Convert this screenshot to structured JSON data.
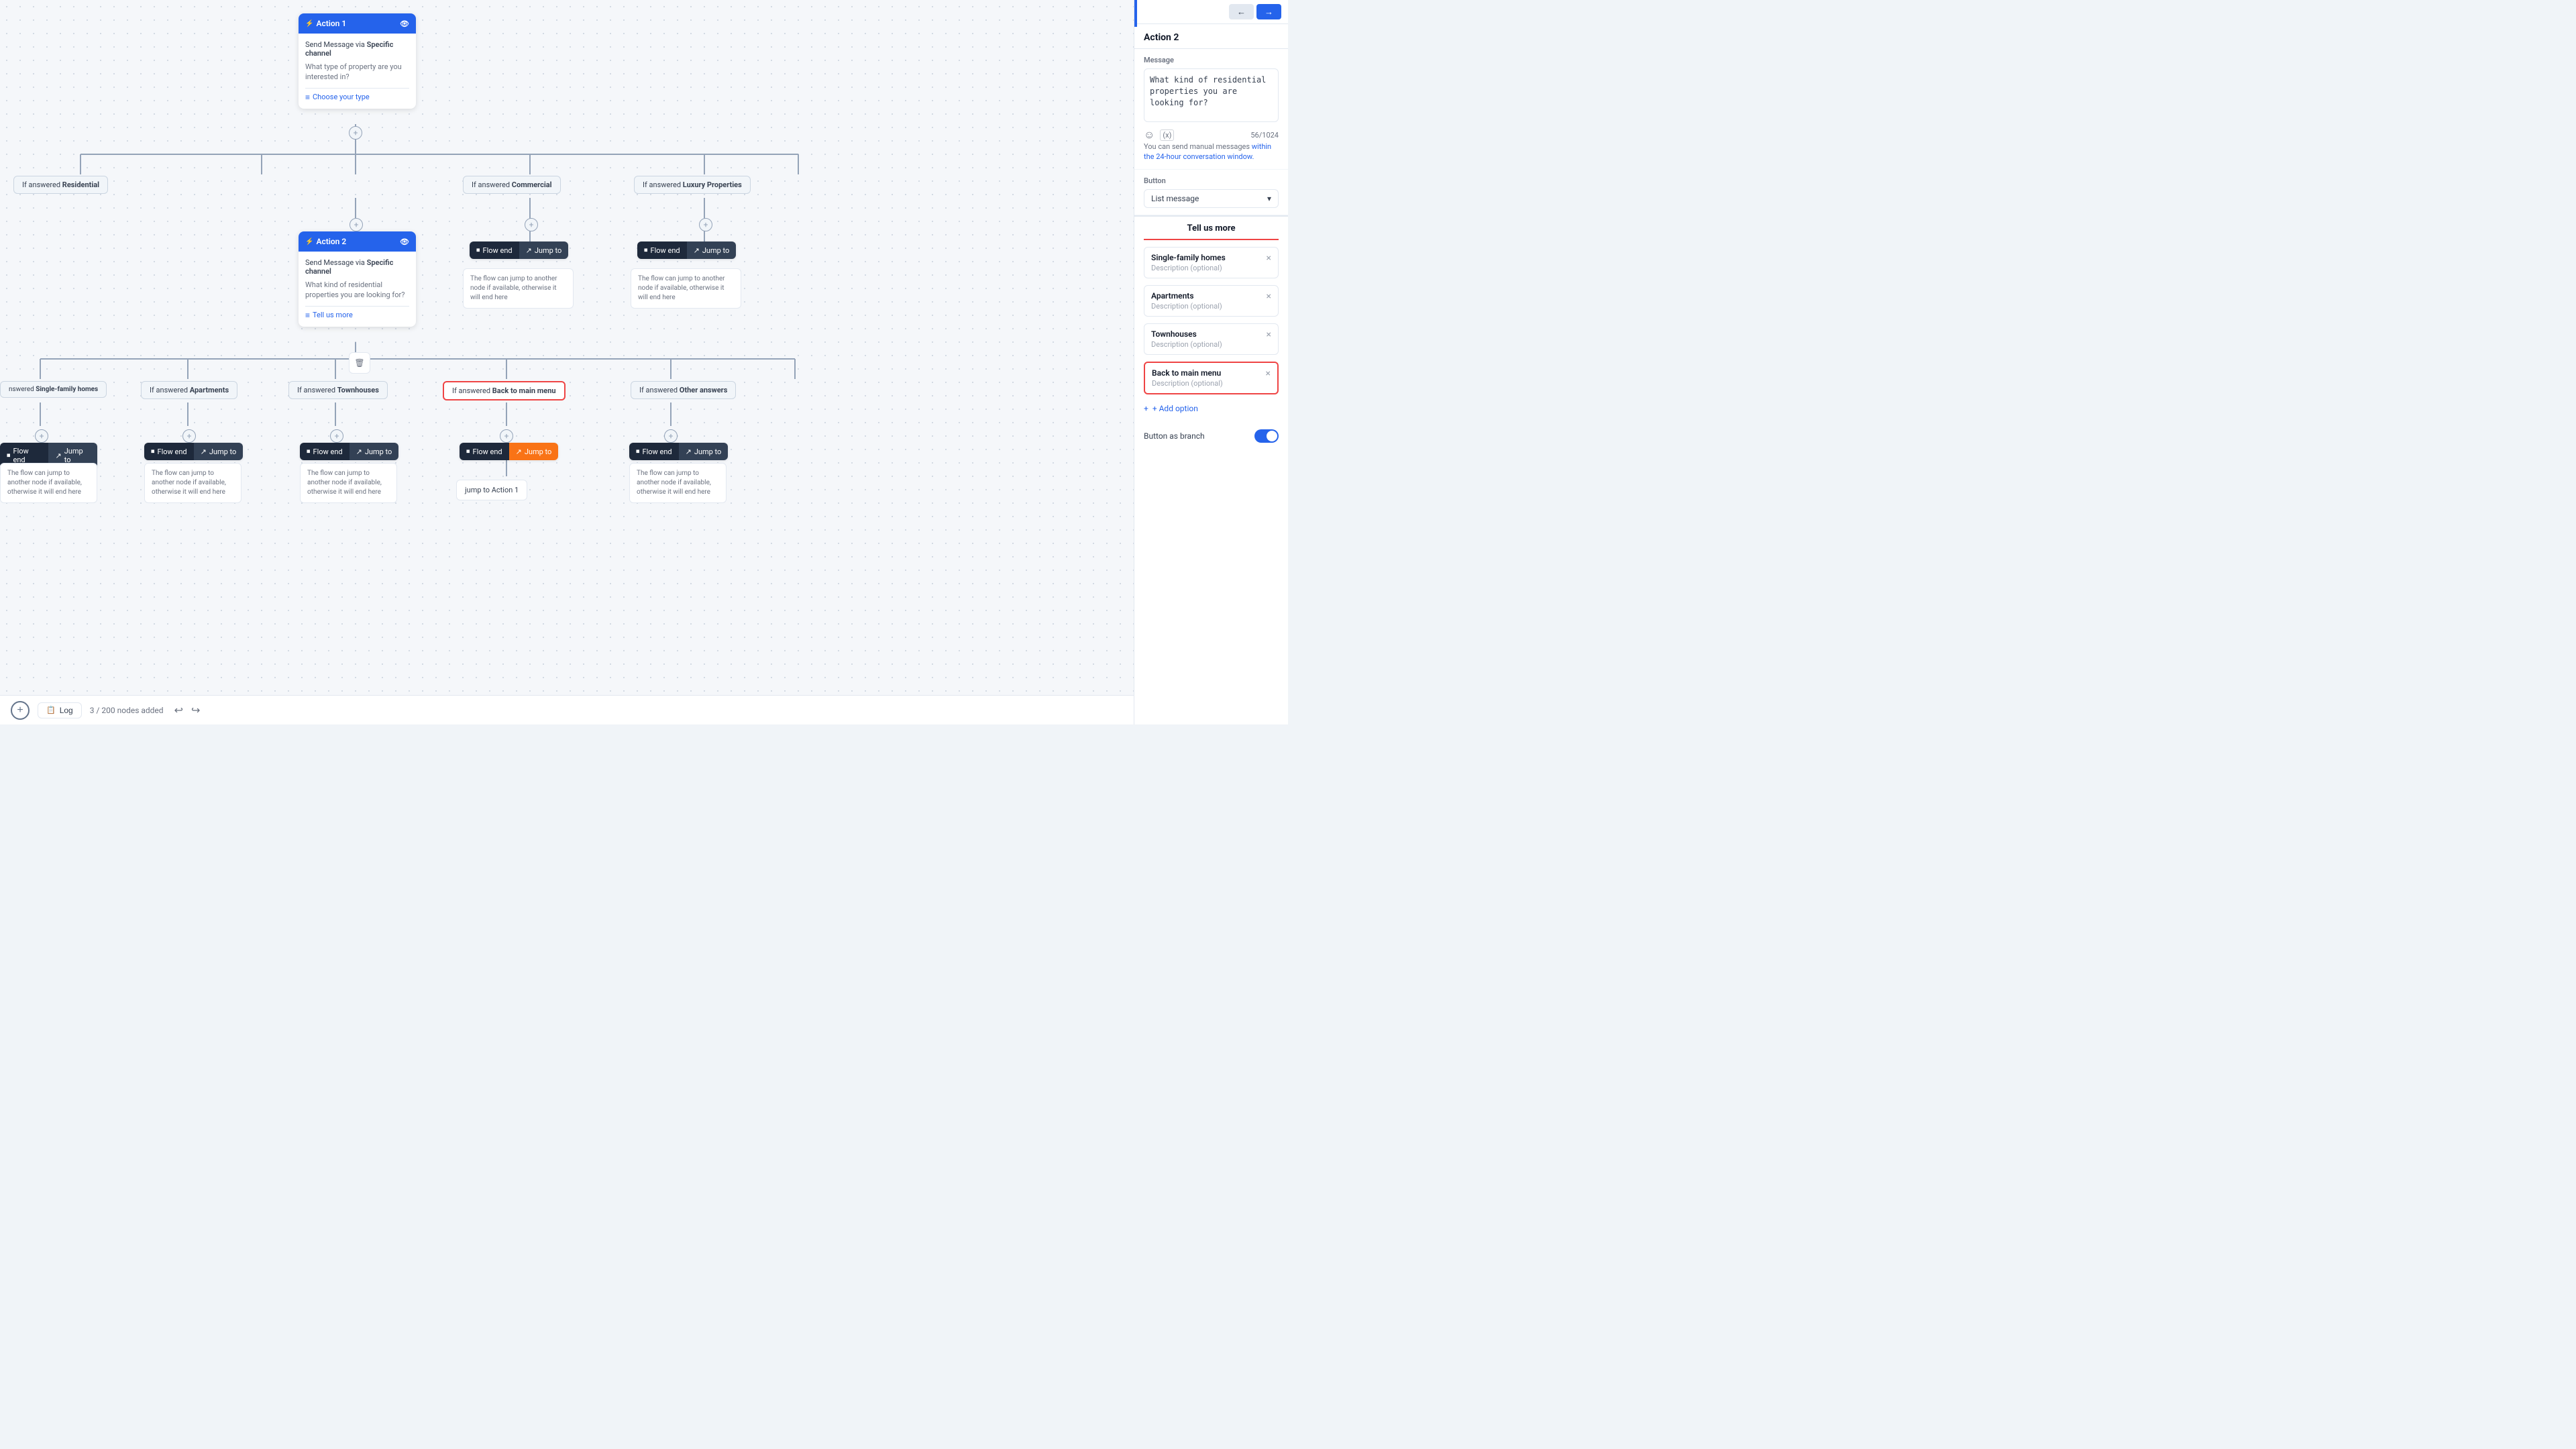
{
  "canvas": {
    "background": "#f5f7fa"
  },
  "toolbar": {
    "add_label": "+",
    "log_label": "Log",
    "nodes_count": "3 / 200 nodes added",
    "undo_label": "↩",
    "redo_label": "↪"
  },
  "nodes": {
    "action1": {
      "title": "Action 1",
      "send_msg_label": "Send Message",
      "via_label": "via",
      "channel_label": "Specific channel",
      "question": "What type of property are you interested in?",
      "button_label": "Choose your type"
    },
    "action2": {
      "title": "Action 2",
      "send_msg_label": "Send Message",
      "via_label": "via",
      "channel_label": "Specific channel",
      "question": "What kind of residential properties you are looking for?",
      "button_label": "Tell us more"
    }
  },
  "conditions": {
    "residential": "If answered Residential",
    "commercial": "If answered Commercial",
    "luxury": "If answered Luxury Properties",
    "single_family": "If answered Single-family homes",
    "apartments": "If answered Apartments",
    "townhouses": "If answered Townhouses",
    "back_to_main": "If answered Back to main menu",
    "other_answers": "If answered Other answers"
  },
  "end_jump": {
    "flow_end": "Flow end",
    "jump_to": "Jump to"
  },
  "flow_end_desc": "The flow can jump to another node if available, otherwise it will end here",
  "jump_to_action1": "jump to Action 1",
  "right_panel": {
    "title": "Action 2",
    "tabs": [
      {
        "label": "←",
        "id": "back"
      },
      {
        "label": "→",
        "id": "forward"
      }
    ],
    "message_section": {
      "label": "Message",
      "value": "What kind of residential properties you are looking for?",
      "char_count": "56/1024",
      "manual_msg": "You can send manual messages ",
      "manual_msg_link": "within the 24-hour conversation window.",
      "emoji_icon": "☺",
      "variable_icon": "{x}"
    },
    "button_section": {
      "label": "Button",
      "dropdown_value": "List message",
      "dropdown_icon": "▾"
    },
    "list_message": {
      "title": "Tell us more",
      "options": [
        {
          "name": "Single-family homes",
          "desc": "Description (optional)",
          "highlighted": false
        },
        {
          "name": "Apartments",
          "desc": "Description (optional)",
          "highlighted": false
        },
        {
          "name": "Townhouses",
          "desc": "Description (optional)",
          "highlighted": false
        },
        {
          "name": "Back to main menu",
          "desc": "Description (optional)",
          "highlighted": true
        }
      ],
      "add_option_label": "+ Add option"
    },
    "branch_as_button": {
      "label": "Button as branch",
      "enabled": true
    }
  }
}
